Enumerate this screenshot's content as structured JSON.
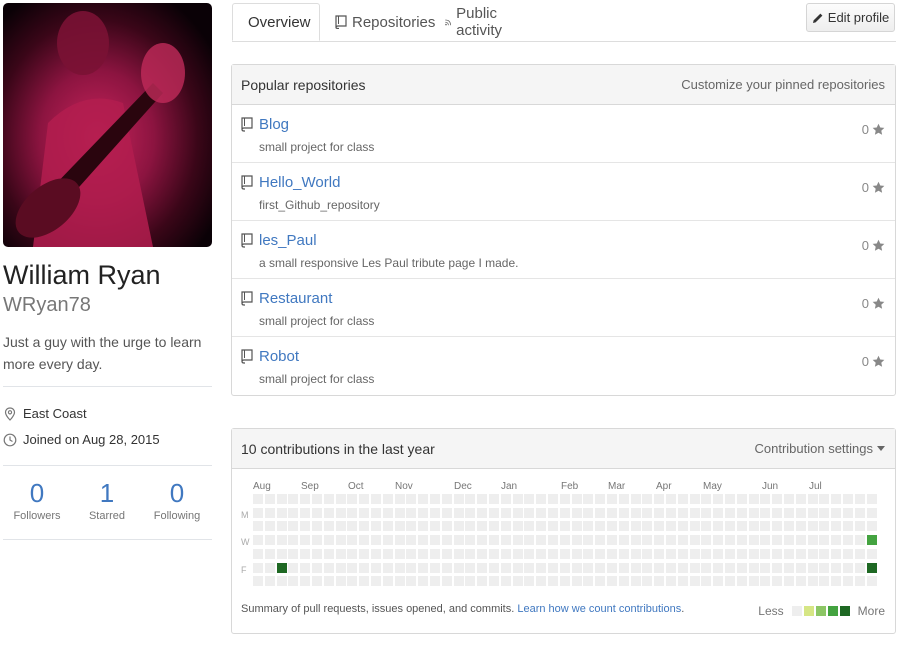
{
  "profile": {
    "full_name": "William Ryan",
    "username": "WRyan78",
    "bio": "Just a guy with the urge to learn more every day.",
    "location": "East Coast",
    "joined": "Joined on Aug 28, 2015",
    "stats": [
      {
        "value": "0",
        "label": "Followers"
      },
      {
        "value": "1",
        "label": "Starred"
      },
      {
        "value": "0",
        "label": "Following"
      }
    ]
  },
  "tabs": [
    {
      "label": "Overview",
      "icon": "person-icon",
      "active": true
    },
    {
      "label": "Repositories",
      "icon": "repo-icon",
      "active": false
    },
    {
      "label": "Public activity",
      "icon": "rss-icon",
      "active": false
    }
  ],
  "edit_profile_label": "Edit profile",
  "popular": {
    "title": "Popular repositories",
    "customize_label": "Customize your pinned repositories",
    "repos": [
      {
        "name": "Blog",
        "description": "small project for class",
        "stars": "0"
      },
      {
        "name": "Hello_World",
        "description": "first_Github_repository",
        "stars": "0"
      },
      {
        "name": "les_Paul",
        "description": "a small responsive Les Paul tribute page I made.",
        "stars": "0"
      },
      {
        "name": "Restaurant",
        "description": "small project for class",
        "stars": "0"
      },
      {
        "name": "Robot",
        "description": "small project for class",
        "stars": "0"
      }
    ]
  },
  "contributions": {
    "title": "10 contributions in the last year",
    "settings_label": "Contribution settings",
    "months": [
      "Aug",
      "Sep",
      "Oct",
      "Nov",
      "Dec",
      "Jan",
      "Feb",
      "Mar",
      "Apr",
      "May",
      "Jun",
      "Jul"
    ],
    "day_labels": [
      "M",
      "W",
      "F"
    ],
    "summary_text": "Summary of pull requests, issues opened, and commits.",
    "summary_link": "Learn how we count contributions",
    "summary_end": ".",
    "legend_less": "Less",
    "legend_more": "More",
    "colors": [
      "#eeeeee",
      "#d6e685",
      "#8cc665",
      "#44a340",
      "#1e6823"
    ],
    "active_cells": [
      {
        "week": 2,
        "day": 5,
        "level": 4
      },
      {
        "week": 52,
        "day": 3,
        "level": 3
      },
      {
        "week": 52,
        "day": 5,
        "level": 4
      }
    ]
  }
}
